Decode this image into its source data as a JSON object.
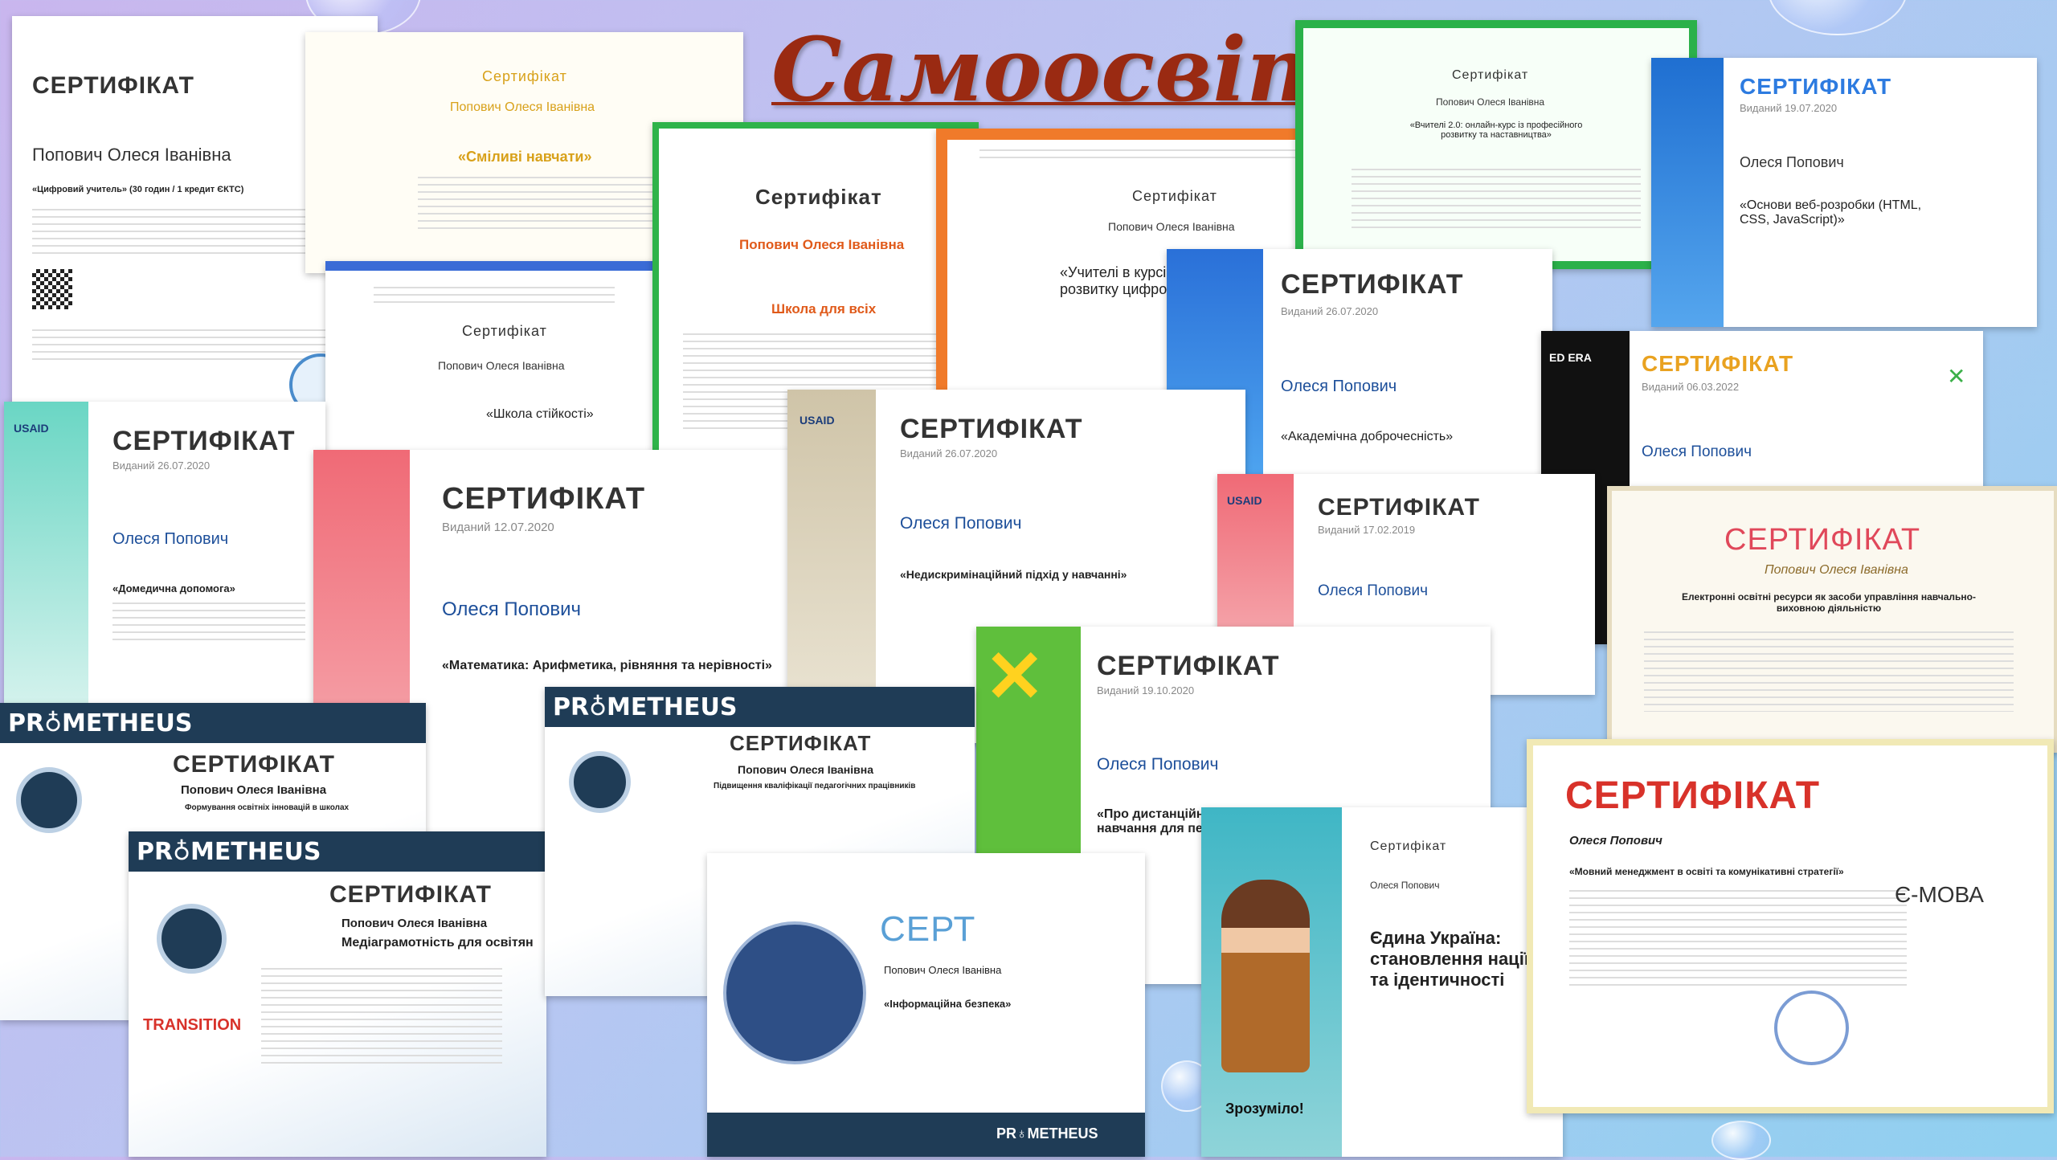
{
  "slide": {
    "title": "Самоосвіта:"
  },
  "certs": [
    {
      "title": "СЕРТИФІКАТ",
      "name": "Попович Олеся Іванівна",
      "course": "«Цифровий учитель» (30 годин / 1 кредит ЄКТС)"
    },
    {
      "title": "Сертифікат",
      "name": "Попович Олеся Іванівна",
      "course": "«Сміливі навчати»"
    },
    {
      "title": "Сертифікат",
      "name": "Попович Олеся Іванівна",
      "course": "«Школа стійкості»"
    },
    {
      "title": "Сертифікат",
      "name": "Попович Олеся Іванівна",
      "course": "Школа для всіх"
    },
    {
      "title": "Сертифікат",
      "name": "Попович Олеся Іванівна",
      "course": "«Учителі в курсі: з розвитку цифрової»"
    },
    {
      "title": "Сертифікат",
      "name": "Попович Олеся Іванівна",
      "course": "«Вчителі 2.0: онлайн-курс із професійного розвитку та наставництва»"
    },
    {
      "title": "СЕРТИФІКАТ",
      "date": "Виданий 19.07.2020",
      "name": "Олеся Попович",
      "course": "«Основи веб-розробки (HTML, CSS, JavaScript)»"
    },
    {
      "title": "СЕРТИФІКАТ",
      "date": "Виданий 26.07.2020",
      "name": "Олеся Попович",
      "course": "«Академічна доброчесність»"
    },
    {
      "title": "СЕРТИФІКАТ",
      "date": "Виданий 06.03.2022",
      "name": "Олеся Попович"
    },
    {
      "title": "СЕРТИФІКАТ",
      "date": "Виданий 26.07.2020",
      "name": "Олеся Попович",
      "course": "«Домедична допомога»"
    },
    {
      "title": "СЕРТИФІКАТ",
      "date": "Виданий 12.07.2020",
      "name": "Олеся Попович",
      "course": "«Математика: Арифметика, рівняння та нерівності»"
    },
    {
      "title": "СЕРТИФІКАТ",
      "date": "Виданий 26.07.2020",
      "name": "Олеся Попович",
      "course": "«Недискримінаційний підхід у навчанні»"
    },
    {
      "title": "СЕРТИФІКАТ",
      "date": "Виданий 17.02.2019",
      "name": "Олеся Попович"
    },
    {
      "title": "СЕРТИФІКАТ",
      "name": "Попович Олеся Іванівна",
      "course": "Електронні освітні ресурси як засоби управління навчально-виховною діяльністю"
    },
    {
      "title": "СЕРТИФІКАТ",
      "date": "Виданий 19.10.2020",
      "name": "Олеся Попович",
      "course": "«Про дистанційне навчання для педагогів»"
    },
    {
      "title": "СЕРТИФІКАТ",
      "name": "Попович Олеся Іванівна",
      "course": "Формування освітніх інновацій в школах"
    },
    {
      "title": "СЕРТИФІКАТ",
      "name": "Попович Олеся Іванівна",
      "course": "Медіаграмотність для освітян"
    },
    {
      "title": "СЕРТИФІКАТ",
      "name": "Попович Олеся Іванівна",
      "course": "Підвищення кваліфікації педагогічних працівників"
    },
    {
      "title": "СЕРТ",
      "name": "Попович Олеся Іванівна",
      "course": "«Інформаційна безпека»"
    },
    {
      "title": "Сертифікат",
      "name": "Олеся Попович",
      "course": "Єдина Україна: становлення нації та ідентичності"
    },
    {
      "title": "СЕРТИФІКАТ",
      "name": "Олеся Попович",
      "course": "«Мовний менеджмент в освіті та комунікативні стратегії»"
    }
  ],
  "logos": {
    "prometheus": "PR♁METHEUS",
    "transition": "TRANSITION",
    "emova": "Є-МОВА",
    "zrozumilo": "Зрозуміло!",
    "usaid": "USAID",
    "edera": "ED ERA",
    "prometheus_footer": "PR♁METHEUS"
  }
}
